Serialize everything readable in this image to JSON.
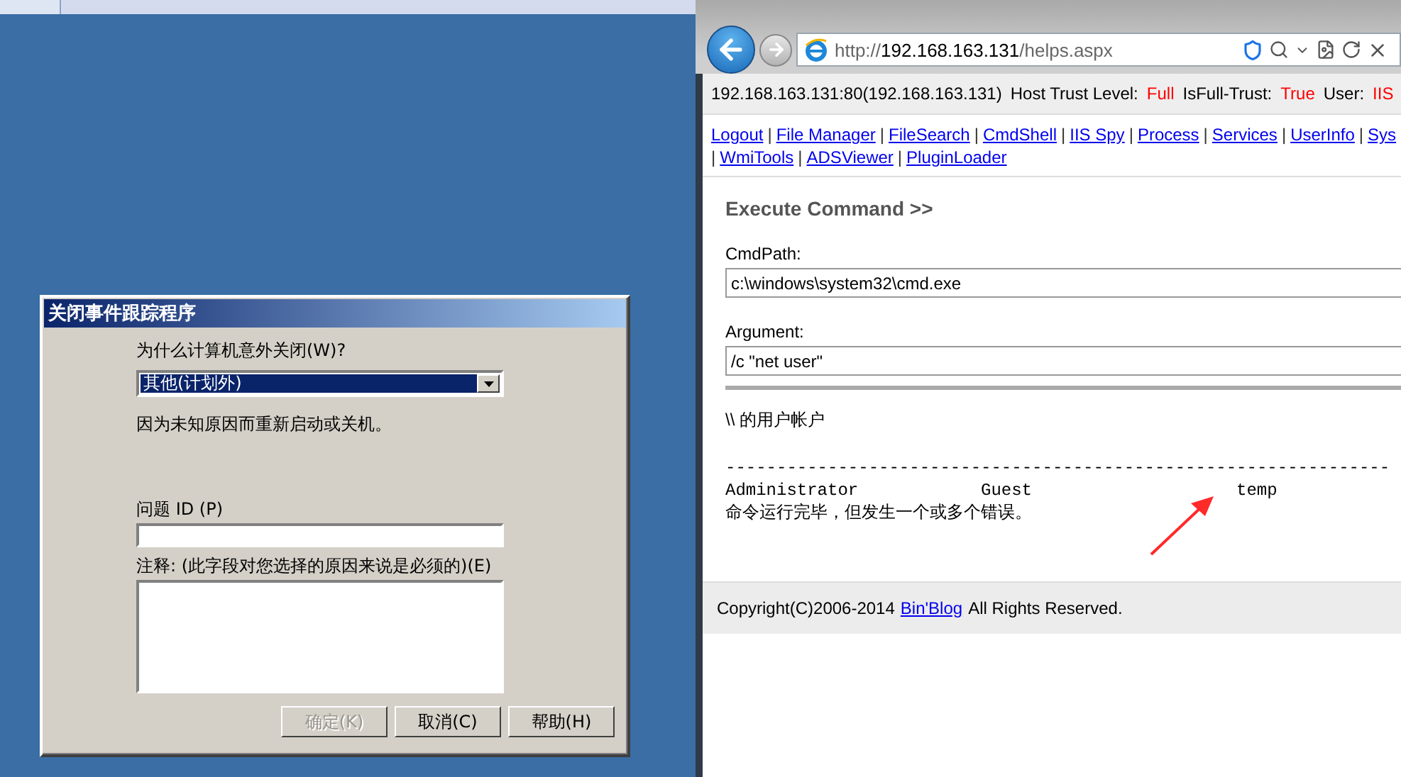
{
  "dialog": {
    "title": "关闭事件跟踪程序",
    "reason_label": "为什么计算机意外关闭(W)?",
    "reason_select": {
      "value": "其他(计划外)"
    },
    "reason_description": "因为未知原因而重新启动或关机。",
    "problem_id": {
      "label": "问题 ID (P)"
    },
    "comment": {
      "label": "注释: (此字段对您选择的原因来说是必须的)(E)"
    },
    "buttons": [
      {
        "label": "确定(K)",
        "disabled": true
      },
      {
        "label": "取消(C)",
        "disabled": false
      },
      {
        "label": "帮助(H)",
        "disabled": false
      }
    ]
  },
  "browser": {
    "address": {
      "scheme": "http://",
      "host": "192.168.163.131",
      "path": "/helps.aspx"
    },
    "info_bar": [
      {
        "kind": "label",
        "text": "192.168.163.131:80(192.168.163.131)"
      },
      {
        "kind": "label",
        "text": "Host Trust Level:"
      },
      {
        "kind": "value",
        "text": "Full"
      },
      {
        "kind": "label",
        "text": "IsFull-Trust:"
      },
      {
        "kind": "value",
        "text": "True"
      },
      {
        "kind": "label",
        "text": "User:"
      },
      {
        "kind": "value",
        "text": "IIS"
      }
    ],
    "nav_rows": [
      [
        {
          "kind": "link",
          "text": "Logout"
        },
        {
          "kind": "sep",
          "text": "|"
        },
        {
          "kind": "link",
          "text": "File Manager"
        },
        {
          "kind": "sep",
          "text": "|"
        },
        {
          "kind": "link",
          "text": "FileSearch"
        },
        {
          "kind": "sep",
          "text": "|"
        },
        {
          "kind": "link",
          "text": "CmdShell"
        },
        {
          "kind": "sep",
          "text": "|"
        },
        {
          "kind": "link",
          "text": "IIS Spy"
        },
        {
          "kind": "sep",
          "text": "|"
        },
        {
          "kind": "link",
          "text": "Process"
        },
        {
          "kind": "sep",
          "text": "|"
        },
        {
          "kind": "link",
          "text": "Services"
        },
        {
          "kind": "sep",
          "text": "|"
        },
        {
          "kind": "link",
          "text": "UserInfo"
        },
        {
          "kind": "sep",
          "text": "|"
        },
        {
          "kind": "link",
          "text": "Sys"
        }
      ],
      [
        {
          "kind": "sep",
          "text": "|"
        },
        {
          "kind": "link",
          "text": "WmiTools"
        },
        {
          "kind": "sep",
          "text": "|"
        },
        {
          "kind": "link",
          "text": "ADSViewer"
        },
        {
          "kind": "sep",
          "text": "|"
        },
        {
          "kind": "link",
          "text": "PluginLoader"
        }
      ]
    ],
    "heading": "Execute Command >>",
    "fields": [
      {
        "label": "CmdPath:",
        "value": "c:\\windows\\system32\\cmd.exe"
      },
      {
        "label": "Argument:",
        "value": "/c \"net user\""
      }
    ],
    "output": {
      "header": "\\\\ 的用户帐户",
      "rule": "-----------------------------------------------------------------",
      "accounts": [
        "Administrator",
        "Guest",
        "temp"
      ],
      "result": "命令运行完毕，但发生一个或多个错误。"
    },
    "footer": {
      "before": "Copyright(C)2006-2014",
      "link": "Bin'Blog",
      "after": "All Rights Reserved."
    }
  }
}
